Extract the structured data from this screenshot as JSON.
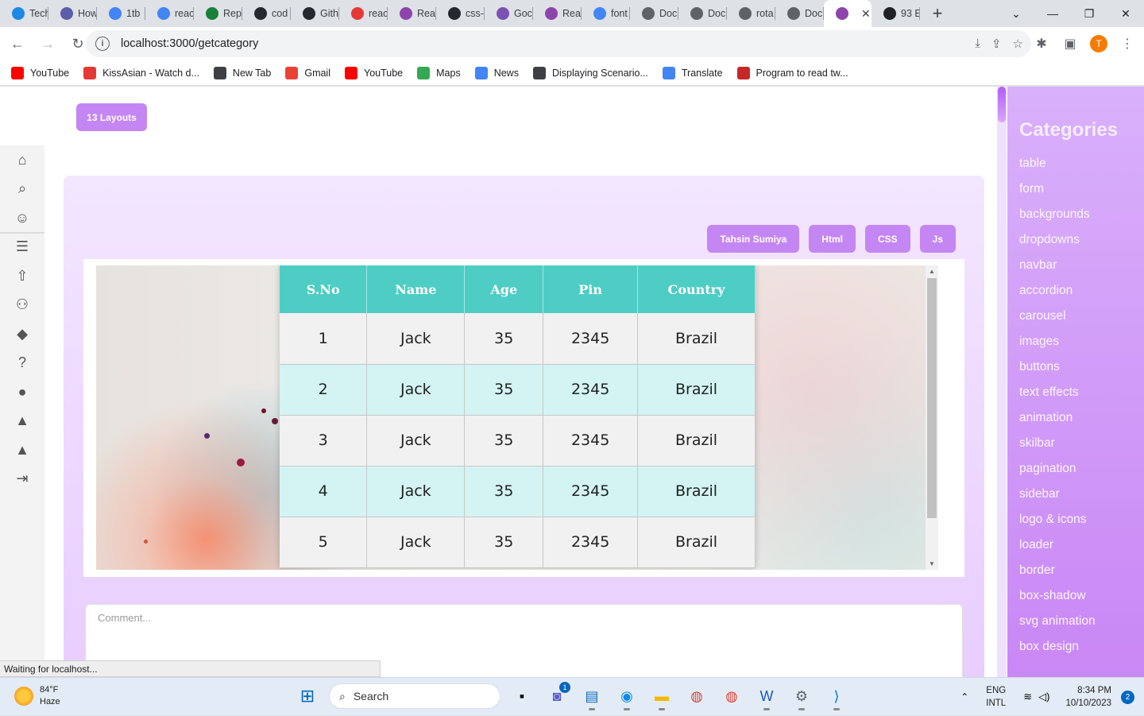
{
  "browser": {
    "tabs": [
      {
        "label": "Tech",
        "color": "#1e88e5"
      },
      {
        "label": "How",
        "color": "#5b5ea6"
      },
      {
        "label": "1tb",
        "color": "#4285f4"
      },
      {
        "label": "reac",
        "color": "#4285f4"
      },
      {
        "label": "Rep",
        "color": "#188038"
      },
      {
        "label": "cod",
        "color": "#24292f"
      },
      {
        "label": "Gith",
        "color": "#24292f"
      },
      {
        "label": "reac",
        "color": "#e53935"
      },
      {
        "label": "Rea",
        "color": "#8e44ad"
      },
      {
        "label": "css-",
        "color": "#24292f"
      },
      {
        "label": "Goc",
        "color": "#7952b3"
      },
      {
        "label": "Rea",
        "color": "#8e44ad"
      },
      {
        "label": "font",
        "color": "#4285f4"
      },
      {
        "label": "Doc",
        "color": "#5f6368"
      },
      {
        "label": "Doc",
        "color": "#5f6368"
      },
      {
        "label": "rota",
        "color": "#5f6368"
      },
      {
        "label": "Doc",
        "color": "#5f6368"
      },
      {
        "label": "",
        "color": "#8e44ad"
      },
      {
        "label": "93 E",
        "color": "#202124"
      }
    ],
    "url": "localhost:3000/getcategory",
    "profile_initial": "T",
    "bookmarks": [
      {
        "label": "YouTube",
        "color": "#ff0000"
      },
      {
        "label": "KissAsian - Watch d...",
        "color": "#e53935"
      },
      {
        "label": "New Tab",
        "color": "#3c4043"
      },
      {
        "label": "Gmail",
        "color": "#ea4335"
      },
      {
        "label": "YouTube",
        "color": "#ff0000"
      },
      {
        "label": "Maps",
        "color": "#34a853"
      },
      {
        "label": "News",
        "color": "#4285f4"
      },
      {
        "label": "Displaying Scenario...",
        "color": "#3c4043"
      },
      {
        "label": "Translate",
        "color": "#4285f4"
      },
      {
        "label": "Program to read tw...",
        "color": "#c62828"
      }
    ],
    "status_text": "Waiting for localhost..."
  },
  "page": {
    "layouts_button": "13 Layouts",
    "pills": [
      "Tahsin Sumiya",
      "Html",
      "CSS",
      "Js"
    ],
    "table": {
      "headers": [
        "S.No",
        "Name",
        "Age",
        "Pin",
        "Country"
      ],
      "rows": [
        [
          "1",
          "Jack",
          "35",
          "2345",
          "Brazil"
        ],
        [
          "2",
          "Jack",
          "35",
          "2345",
          "Brazil"
        ],
        [
          "3",
          "Jack",
          "35",
          "2345",
          "Brazil"
        ],
        [
          "4",
          "Jack",
          "35",
          "2345",
          "Brazil"
        ],
        [
          "5",
          "Jack",
          "35",
          "2345",
          "Brazil"
        ]
      ]
    },
    "comment_placeholder": "Comment...",
    "categories_title": "Categories",
    "categories": [
      "table",
      "form",
      "backgrounds",
      "dropdowns",
      "navbar",
      "accordion",
      "carousel",
      "images",
      "buttons",
      "text effects",
      "animation",
      "skilbar",
      "pagination",
      "sidebar",
      "logo & icons",
      "loader",
      "border",
      "box-shadow",
      "svg animation",
      "box design"
    ]
  },
  "taskbar": {
    "temperature": "84°F",
    "weather": "Haze",
    "search_label": "Search",
    "lang_top": "ENG",
    "lang_bottom": "INTL",
    "time": "8:34 PM",
    "date": "10/10/2023",
    "notifications": "2",
    "teams_badge": "1"
  }
}
